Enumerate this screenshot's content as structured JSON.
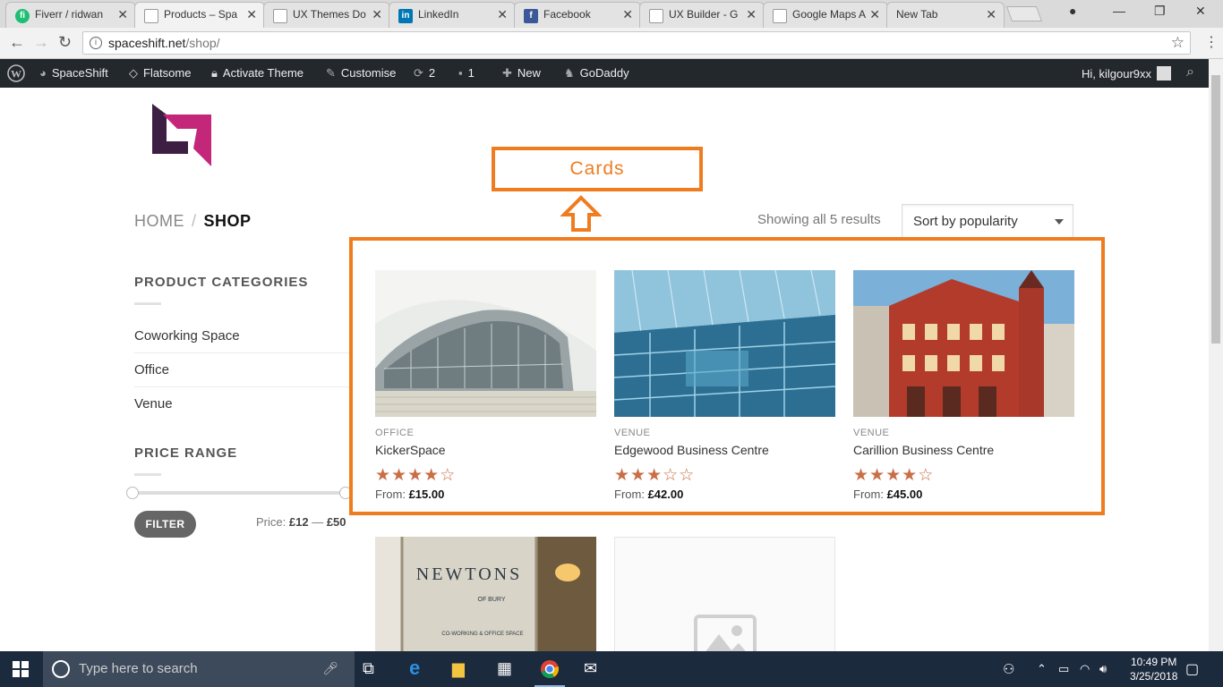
{
  "browser": {
    "tabs": [
      {
        "title": "Fiverr / ridwan",
        "favicon": "fiverr-icon",
        "color": "#1dbf73",
        "glyph": "fi"
      },
      {
        "title": "Products – Spa",
        "favicon": "page-icon",
        "color": "#9e9e9e",
        "glyph": ""
      },
      {
        "title": "UX Themes Do",
        "favicon": "page-icon",
        "color": "#9e9e9e",
        "glyph": ""
      },
      {
        "title": "LinkedIn",
        "favicon": "linkedin-icon",
        "color": "#0077b5",
        "glyph": "in"
      },
      {
        "title": "Facebook",
        "favicon": "facebook-icon",
        "color": "#3b5998",
        "glyph": "f"
      },
      {
        "title": "UX Builder - G",
        "favicon": "page-icon",
        "color": "#9e9e9e",
        "glyph": ""
      },
      {
        "title": "Google Maps A",
        "favicon": "page-icon",
        "color": "#9e9e9e",
        "glyph": ""
      },
      {
        "title": "New Tab",
        "favicon": "none",
        "color": "",
        "glyph": ""
      }
    ],
    "url_host": "spaceshift.net",
    "url_path": "/shop/"
  },
  "adminbar": {
    "site": "SpaceShift",
    "theme": "Flatsome",
    "activate": "Activate Theme",
    "customise": "Customise",
    "updates_count": "2",
    "comments_count": "1",
    "new": "New",
    "godaddy": "GoDaddy",
    "greeting": "Hi, kilgour9xx"
  },
  "shop": {
    "breadcrumb_home": "HOME",
    "breadcrumb_sep": "/",
    "breadcrumb_current": "SHOP",
    "result_count": "Showing all 5 results",
    "sort_value": "Sort by popularity",
    "categories_title": "PRODUCT CATEGORIES",
    "categories": [
      "Coworking Space",
      "Office",
      "Venue"
    ],
    "price_title": "PRICE RANGE",
    "filter_label": "FILTER",
    "price_prefix": "Price:",
    "price_min": "£12",
    "price_dash": "—",
    "price_max": "£50",
    "products": [
      {
        "category": "OFFICE",
        "name": "KickerSpace",
        "rating": 4,
        "price_prefix": "From:",
        "price": "£15.00"
      },
      {
        "category": "VENUE",
        "name": "Edgewood Business Centre",
        "rating": 3,
        "price_prefix": "From:",
        "price": "£42.00"
      },
      {
        "category": "VENUE",
        "name": "Carillion Business Centre",
        "rating": 4,
        "price_prefix": "From:",
        "price": "£45.00"
      }
    ],
    "sign_text": "NEWTONS",
    "sign_sub": "OF BURY",
    "sign_sub2": "CO-WORKING & OFFICE SPACE"
  },
  "annotation": {
    "label": "Cards",
    "color": "#f07c20"
  },
  "taskbar": {
    "search_placeholder": "Type here to search",
    "time": "10:49 PM",
    "date": "3/25/2018"
  }
}
